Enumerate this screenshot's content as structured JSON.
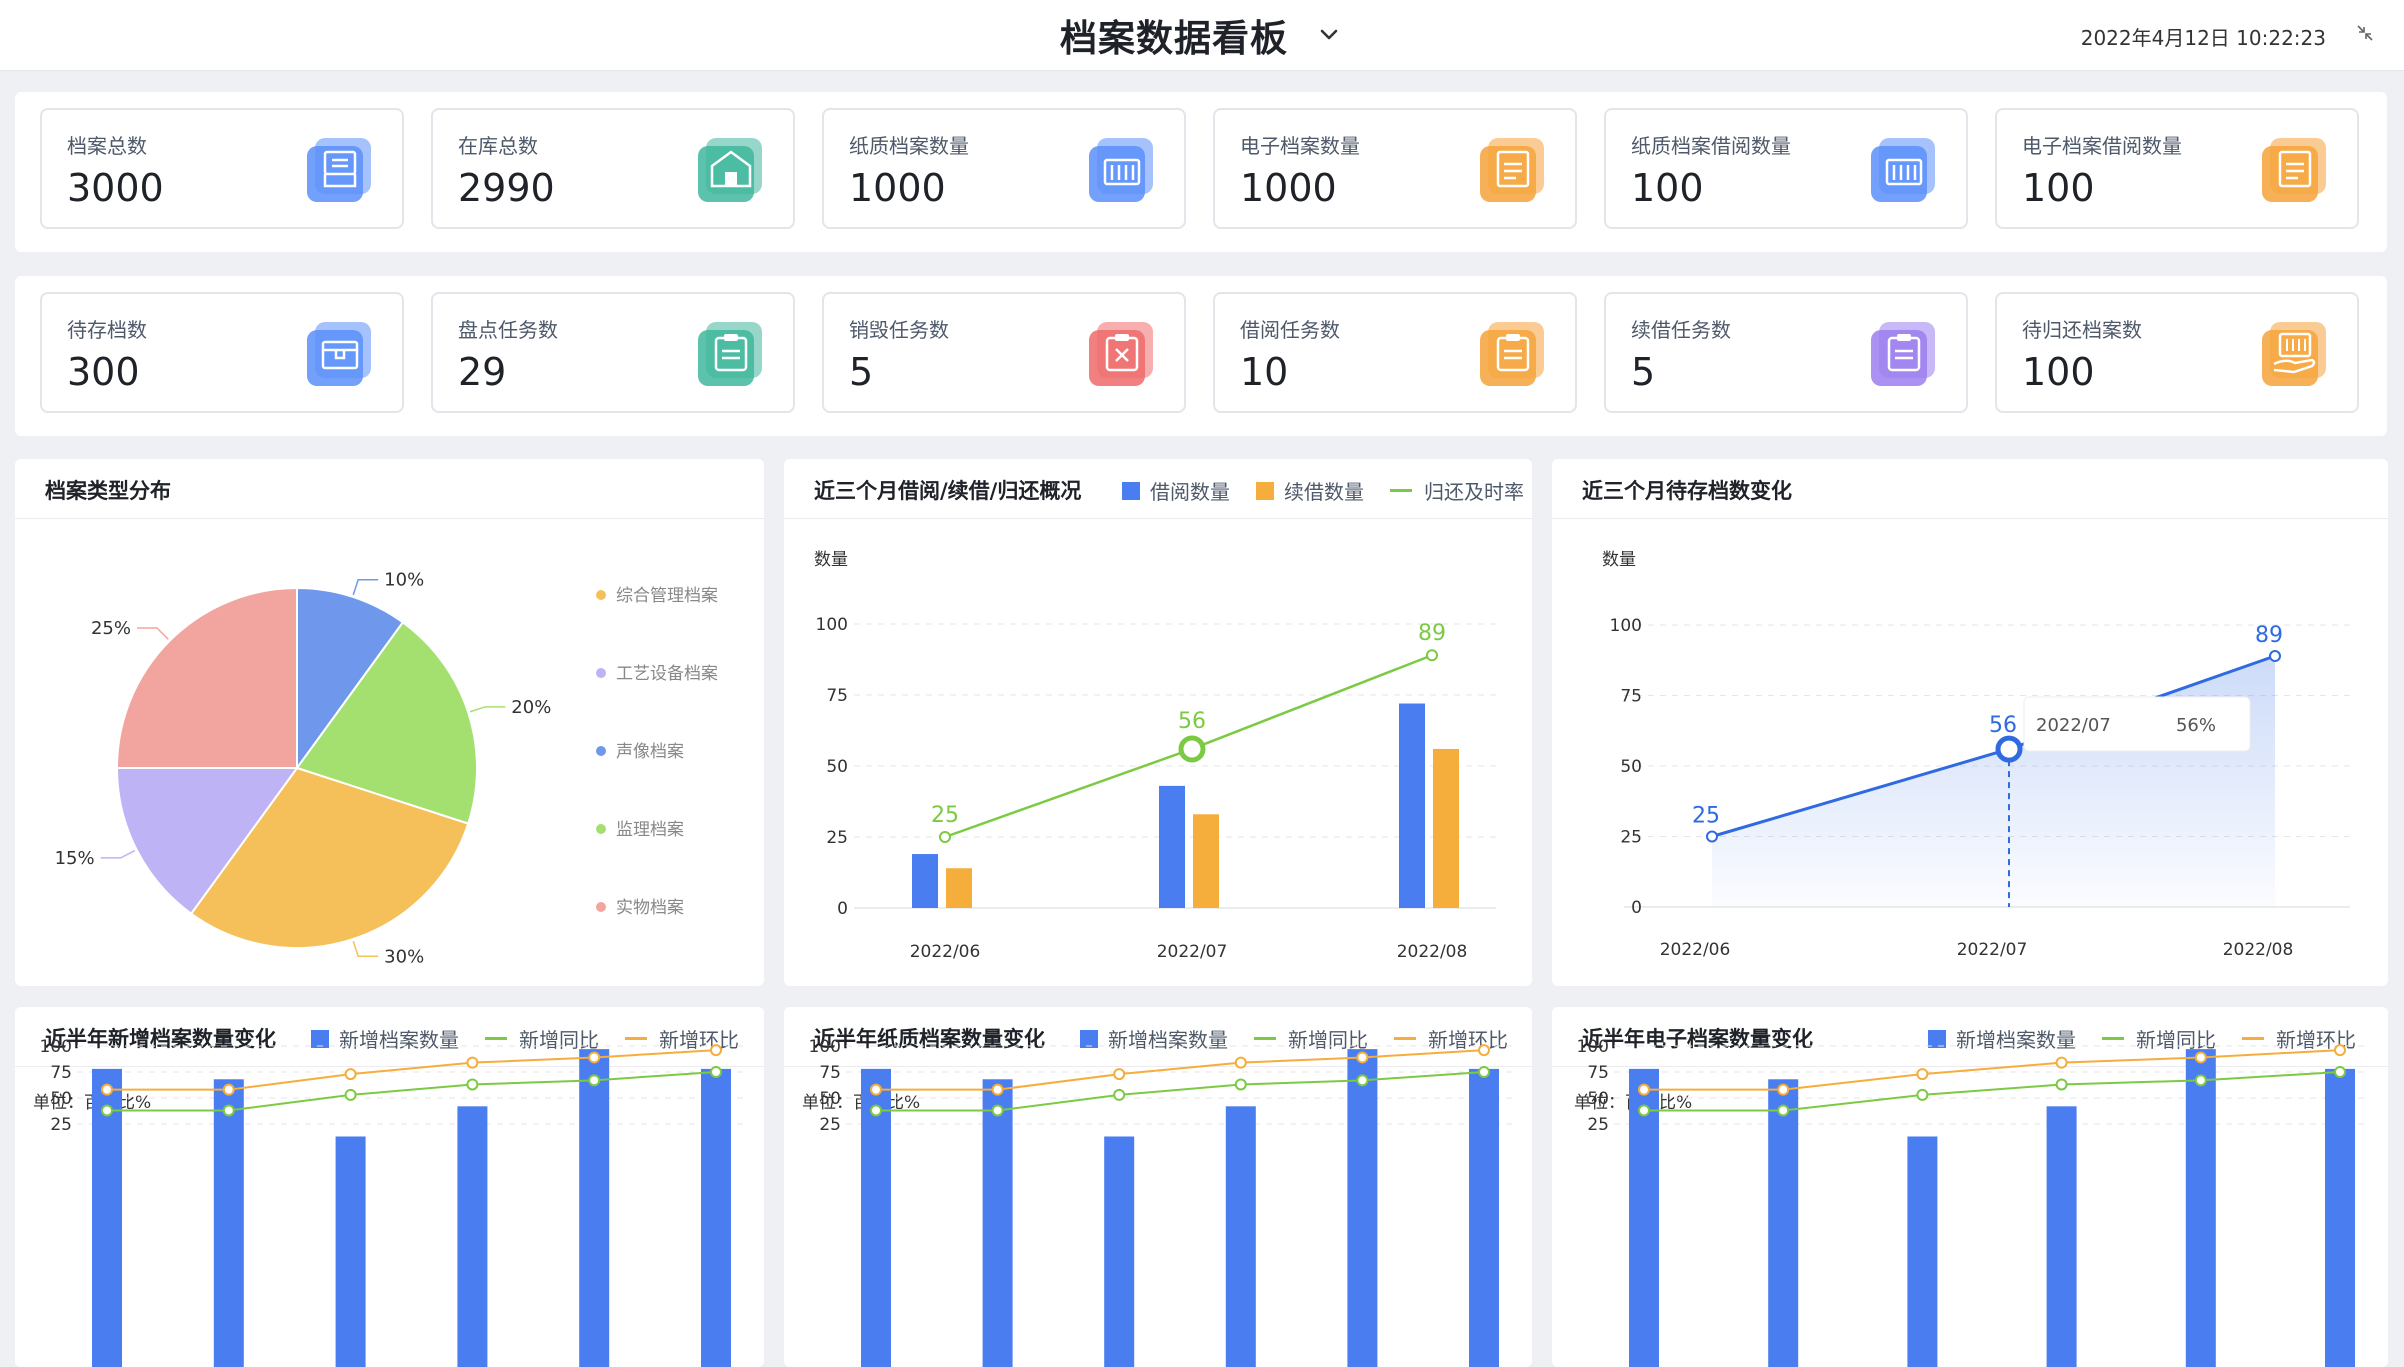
{
  "header": {
    "title": "档案数据看板",
    "datetime": "2022年4月12日 10:22:23"
  },
  "stats_row1": [
    {
      "label": "档案总数",
      "value": "3000",
      "icon": "archive-tray-icon",
      "color": "#5b8ff9"
    },
    {
      "label": "在库总数",
      "value": "2990",
      "icon": "warehouse-icon",
      "color": "#3fb79c"
    },
    {
      "label": "纸质档案数量",
      "value": "1000",
      "icon": "paper-files-icon",
      "color": "#5b8ff9"
    },
    {
      "label": "电子档案数量",
      "value": "1000",
      "icon": "document-icon",
      "color": "#f5a33b"
    },
    {
      "label": "纸质档案借阅数量",
      "value": "100",
      "icon": "paper-files-icon",
      "color": "#5b8ff9"
    },
    {
      "label": "电子档案借阅数量",
      "value": "100",
      "icon": "document-icon",
      "color": "#f5a33b"
    }
  ],
  "stats_row2": [
    {
      "label": "待存档数",
      "value": "300",
      "icon": "box-icon",
      "color": "#5b8ff9"
    },
    {
      "label": "盘点任务数",
      "value": "29",
      "icon": "clipboard-icon",
      "color": "#3fb79c"
    },
    {
      "label": "销毁任务数",
      "value": "5",
      "icon": "clipboard-x-icon",
      "color": "#ef6b6b"
    },
    {
      "label": "借阅任务数",
      "value": "10",
      "icon": "clipboard-icon",
      "color": "#f5a33b"
    },
    {
      "label": "续借任务数",
      "value": "5",
      "icon": "clipboard-icon",
      "color": "#9b7ef0"
    },
    {
      "label": "待归还档案数",
      "value": "100",
      "icon": "hand-files-icon",
      "color": "#f5a33b"
    }
  ],
  "pie_panel": {
    "title": "档案类型分布"
  },
  "borrow_panel": {
    "title": "近三个月借阅/续借/归还概况",
    "legend": [
      "借阅数量",
      "续借数量",
      "归还及时率"
    ],
    "unit": "数量"
  },
  "pending_panel": {
    "title": "近三个月待存档数变化",
    "unit": "数量"
  },
  "half_year_panels": [
    {
      "title": "近半年新增档案数量变化"
    },
    {
      "title": "近半年纸质档案数量变化"
    },
    {
      "title": "近半年电子档案数量变化"
    }
  ],
  "half_year_legend": [
    "新增档案数量",
    "新增同比",
    "新增环比"
  ],
  "half_year_unit": "单位：百分比%",
  "colors": {
    "blue": "#4a7df0",
    "orange": "#f5ad3b",
    "green": "#7cc943",
    "pink": "#f2a59f",
    "purple": "#bdb3f5",
    "yellowpie": "#f5c05a",
    "greenpie": "#a3e070",
    "bluepie": "#6f98ec"
  },
  "chart_data": [
    {
      "type": "pie",
      "title": "档案类型分布",
      "slices": [
        {
          "name": "声像档案",
          "value": 10,
          "label": "10%",
          "color": "#6f98ec"
        },
        {
          "name": "监理档案",
          "value": 20,
          "label": "20%",
          "color": "#a3e070"
        },
        {
          "name": "综合管理档案",
          "value": 30,
          "label": "30%",
          "color": "#f5c05a"
        },
        {
          "name": "工艺设备档案",
          "value": 15,
          "label": "15%",
          "color": "#bdb3f5"
        },
        {
          "name": "实物档案",
          "value": 25,
          "label": "25%",
          "color": "#f2a59f"
        }
      ],
      "legend_order": [
        "综合管理档案",
        "工艺设备档案",
        "声像档案",
        "监理档案",
        "实物档案"
      ],
      "legend_colors": [
        "#f5c05a",
        "#bdb3f5",
        "#6f98ec",
        "#a3e070",
        "#f2a59f"
      ],
      "legend_position": "right"
    },
    {
      "type": "bar",
      "title": "近三个月借阅/续借/归还概况",
      "categories": [
        "2022/06",
        "2022/07",
        "2022/08"
      ],
      "series": [
        {
          "name": "借阅数量",
          "type": "bar",
          "values": [
            19,
            43,
            72
          ],
          "color": "#4a7df0"
        },
        {
          "name": "续借数量",
          "type": "bar",
          "values": [
            14,
            33,
            56
          ],
          "color": "#f5ad3b"
        },
        {
          "name": "归还及时率",
          "type": "line",
          "values": [
            25,
            56,
            89
          ],
          "color": "#7cc943",
          "labels": [
            "25",
            "56",
            "89"
          ]
        }
      ],
      "ylabel": "数量",
      "ylim": [
        0,
        100
      ],
      "yticks": [
        0,
        25,
        50,
        75,
        100
      ],
      "grid": true
    },
    {
      "type": "area",
      "title": "近三个月待存档数变化",
      "categories": [
        "2022/06",
        "2022/07",
        "2022/08"
      ],
      "series": [
        {
          "values": [
            25,
            56,
            89
          ],
          "labels": [
            "25",
            "56",
            "89"
          ],
          "color": "#2f6ae0"
        }
      ],
      "ylabel": "数量",
      "ylim": [
        0,
        100
      ],
      "yticks": [
        0,
        25,
        50,
        75,
        100
      ],
      "grid": true,
      "tooltip": {
        "category": "2022/07",
        "value": "56%"
      }
    },
    {
      "type": "bar",
      "title": "近半年新增档案数量变化",
      "series": [
        {
          "name": "新增档案数量",
          "type": "bar",
          "values": [
            78,
            68,
            13,
            42,
            97,
            78
          ],
          "color": "#4a7df0"
        },
        {
          "name": "新增同比",
          "type": "line",
          "values": [
            38,
            38,
            53,
            63,
            67,
            75
          ],
          "color": "#7cc943"
        },
        {
          "name": "新增环比",
          "type": "line",
          "values": [
            58,
            58,
            73,
            84,
            89,
            96
          ],
          "color": "#f5ad3b"
        }
      ],
      "ylabel": "单位：百分比%",
      "yticks": [
        25,
        50,
        75,
        100
      ],
      "grid": true
    },
    {
      "type": "bar",
      "title": "近半年纸质档案数量变化",
      "series": [
        {
          "name": "新增档案数量",
          "type": "bar",
          "values": [
            78,
            68,
            13,
            42,
            97,
            78
          ],
          "color": "#4a7df0"
        },
        {
          "name": "新增同比",
          "type": "line",
          "values": [
            38,
            38,
            53,
            63,
            67,
            75
          ],
          "color": "#7cc943"
        },
        {
          "name": "新增环比",
          "type": "line",
          "values": [
            58,
            58,
            73,
            84,
            89,
            96
          ],
          "color": "#f5ad3b"
        }
      ],
      "ylabel": "单位：百分比%",
      "yticks": [
        25,
        50,
        75,
        100
      ],
      "grid": true
    },
    {
      "type": "bar",
      "title": "近半年电子档案数量变化",
      "series": [
        {
          "name": "新增档案数量",
          "type": "bar",
          "values": [
            78,
            68,
            13,
            42,
            97,
            78
          ],
          "color": "#4a7df0"
        },
        {
          "name": "新增同比",
          "type": "line",
          "values": [
            38,
            38,
            53,
            63,
            67,
            75
          ],
          "color": "#7cc943"
        },
        {
          "name": "新增环比",
          "type": "line",
          "values": [
            58,
            58,
            73,
            84,
            89,
            96
          ],
          "color": "#f5ad3b"
        }
      ],
      "ylabel": "单位：百分比%",
      "yticks": [
        25,
        50,
        75,
        100
      ],
      "grid": true
    }
  ]
}
